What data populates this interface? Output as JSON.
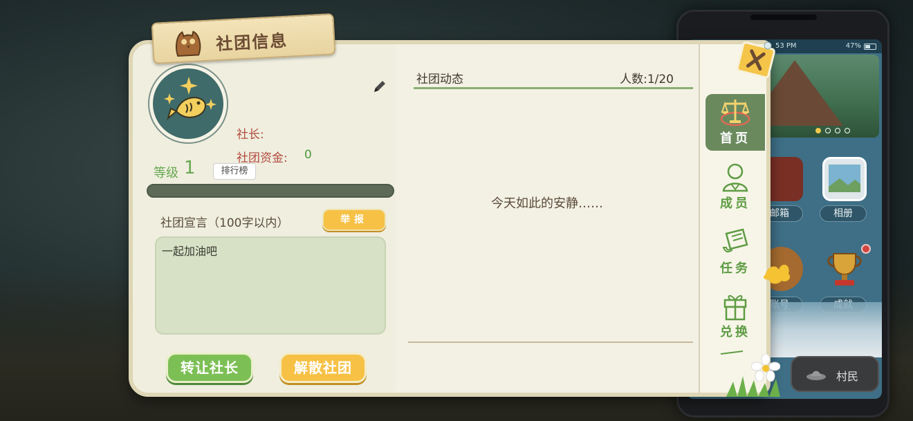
{
  "panel": {
    "title": "社团信息",
    "club": {
      "leader_label": "社长:",
      "funds_label": "社团资金:",
      "funds_value": "0",
      "level_label": "等级",
      "level_value": "1",
      "rank_button": "排行榜",
      "exp_progress": 0
    },
    "declaration": {
      "label": "社团宣言（100字以内）",
      "report_button": "举报",
      "text": "一起加油吧"
    },
    "actions": {
      "transfer_leader": "转让社长",
      "dissolve_club": "解散社团"
    },
    "news": {
      "title": "社团动态",
      "member_count": "人数:1/20",
      "empty_text": "今天如此的安静……"
    },
    "tabs": [
      {
        "label": "首页",
        "icon": "scales-icon",
        "active": true
      },
      {
        "label": "成员",
        "icon": "member-icon",
        "active": false
      },
      {
        "label": "任务",
        "icon": "scroll-icon",
        "active": false
      },
      {
        "label": "兑换",
        "icon": "gift-icon",
        "active": false
      }
    ]
  },
  "phone": {
    "status_time": "53 PM",
    "battery": "47%",
    "apps": [
      {
        "label": "邮箱",
        "icon": "mailbox-icon"
      },
      {
        "label": "相册",
        "icon": "photo-album-icon"
      },
      {
        "label": "账号",
        "icon": "account-icon"
      },
      {
        "label": "成就",
        "icon": "trophy-icon"
      }
    ],
    "villager_button": "村民"
  },
  "colors": {
    "accent_green": "#7cbf55",
    "accent_yellow": "#f6c145",
    "tab_active": "#6a8a5e",
    "label_red": "#b24a3d"
  }
}
